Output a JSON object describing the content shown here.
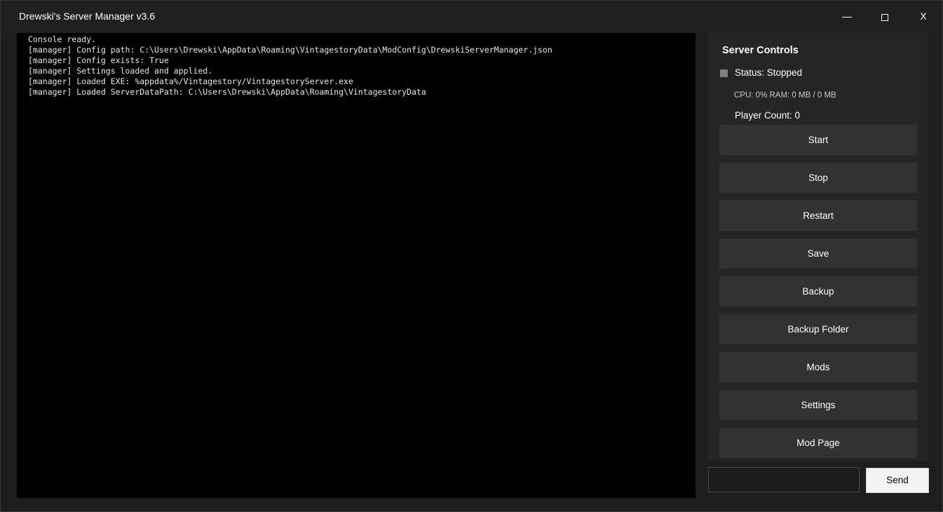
{
  "window": {
    "title": "Drewski's Server Manager v3.6",
    "close_label": "X"
  },
  "console": {
    "lines": [
      "Console ready.",
      "[manager] Config path: C:\\Users\\Drewski\\AppData\\Roaming\\VintagestoryData\\ModConfig\\DrewskiServerManager.json",
      "[manager] Config exists: True",
      "[manager] Settings loaded and applied.",
      "[manager] Loaded EXE: %appdata%/Vintagestory/VintagestoryServer.exe",
      "[manager] Loaded ServerDataPath: C:\\Users\\Drewski\\AppData\\Roaming\\VintagestoryData"
    ]
  },
  "panel": {
    "title": "Server Controls",
    "status": "Status: Stopped",
    "status_color": "#808080",
    "metrics": "CPU: 0%   RAM: 0 MB / 0 MB",
    "player_count": "Player Count: 0",
    "buttons": [
      "Start",
      "Stop",
      "Restart",
      "Save",
      "Backup",
      "Backup Folder",
      "Mods",
      "Settings",
      "Mod Page"
    ]
  },
  "command": {
    "input_value": "",
    "send_label": "Send"
  },
  "colors": {
    "window_bg": "#1e1e1e",
    "console_bg": "#000000",
    "panel_bg": "#252525",
    "button_bg": "#323232",
    "send_bg": "#f3f3f3"
  }
}
